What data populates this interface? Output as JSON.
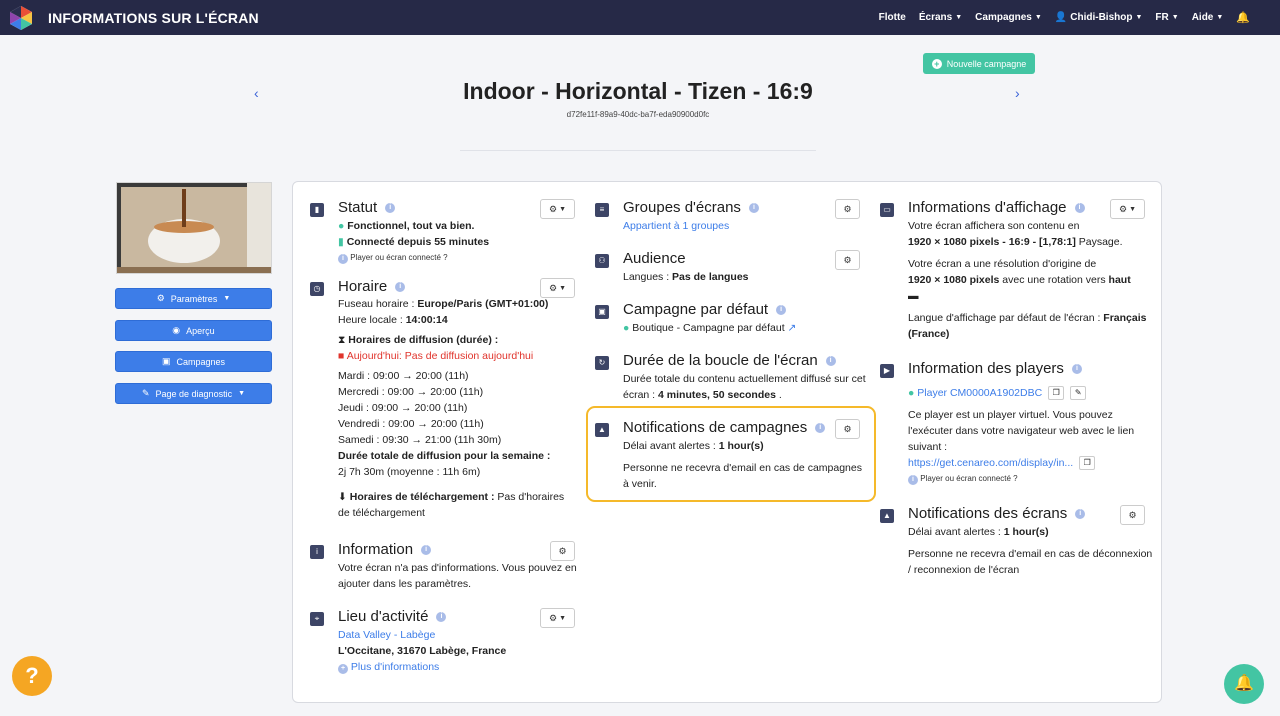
{
  "app": {
    "title": "INFORMATIONS SUR L'ÉCRAN"
  },
  "nav": {
    "items": [
      "Flotte",
      "Écrans",
      "Campagnes",
      "Chidi-Bishop",
      "FR",
      "Aide"
    ]
  },
  "new_campaign": {
    "label": "Nouvelle campagne"
  },
  "screen": {
    "name": "Indoor - Horizontal - Tizen - 16:9",
    "id": "d72fe11f-89a9-40dc-ba7f-eda90900d0fc"
  },
  "sidebar": {
    "buttons": [
      "Paramètres",
      "Aperçu",
      "Campagnes",
      "Page de diagnostic"
    ]
  },
  "statut": {
    "title": "Statut",
    "line1": "Fonctionnel, tout va bien.",
    "line2": "Connecté depuis 55 minutes",
    "note": "Player ou écran connecté ?"
  },
  "horaire": {
    "title": "Horaire",
    "tz_label": "Fuseau horaire : ",
    "tz_value": "Europe/Paris (GMT+01:00)",
    "local_label": "Heure locale : ",
    "local_value": "14:00:14",
    "diff_label": "Horaires de diffusion (durée) :",
    "today": "Aujourd'hui: Pas de diffusion aujourd'hui",
    "days": [
      "Mardi : 09:00 → 20:00 (11h)",
      "Mercredi : 09:00 → 20:00 (11h)",
      "Jeudi : 09:00 → 20:00 (11h)",
      "Vendredi : 09:00 → 20:00 (11h)",
      "Samedi : 09:30 → 21:00 (11h 30m)"
    ],
    "total_label": "Durée totale de diffusion pour la semaine :",
    "total_value": "2j 7h 30m (moyenne : 11h 6m)",
    "dl_label": "Horaires de téléchargement :",
    "dl_value1": " Pas d'horaires",
    "dl_value2": "de téléchargement"
  },
  "information": {
    "title": "Information",
    "line1": "Votre écran n'a pas d'informations. Vous pouvez en",
    "line2": "ajouter dans les paramètres."
  },
  "lieu": {
    "title": "Lieu d'activité",
    "link": "Data Valley - Labège",
    "address": "L'Occitane, 31670 Labège, France",
    "more": "Plus d'informations"
  },
  "groupes": {
    "title": "Groupes d'écrans",
    "value": "Appartient à 1 groupes"
  },
  "audience": {
    "title": "Audience",
    "label": "Langues : ",
    "value": "Pas de langues"
  },
  "campagne_defaut": {
    "title": "Campagne par défaut",
    "value": "Boutique - Campagne par défaut"
  },
  "boucle": {
    "title": "Durée de la boucle de l'écran",
    "line1": "Durée totale du contenu actuellement diffusé sur cet",
    "line2_label": "écran : ",
    "line2_value": "4 minutes, 50 secondes",
    "line2_end": " ."
  },
  "notif_campagnes": {
    "title": "Notifications de campagnes",
    "delay_label": "Délai avant alertes : ",
    "delay_value": "1 hour(s)",
    "line1": "Personne ne recevra d'email en cas de campagnes",
    "line2": "à venir."
  },
  "affichage": {
    "title": "Informations d'affichage",
    "line1": "Votre écran affichera son contenu en",
    "res1": "1920 × 1080 pixels - 16:9 - [1,78:1]",
    "res1_end": " Paysage.",
    "line2": "Votre écran a une résolution d'origine de",
    "res2": "1920  × 1080 pixels",
    "res2_mid": " avec une rotation vers ",
    "res2_end": "haut",
    "lang_label": "Langue d'affichage par défaut de l'écran : ",
    "lang_value": "Français",
    "lang_value2": "(France)"
  },
  "players": {
    "title": "Information des players",
    "player": "Player CM0000A1902DBC",
    "line1": "Ce player est un player virtuel. Vous pouvez",
    "line2": "l'exécuter dans votre navigateur web avec le lien",
    "line3": "suivant :",
    "url": "https://get.cenareo.com/display/in...",
    "note": "Player ou écran connecté ?"
  },
  "notif_ecrans": {
    "title": "Notifications des écrans",
    "delay_label": "Délai avant alertes : ",
    "delay_value": "1 hour(s)",
    "line1": "Personne ne recevra d'email en cas de déconnexion",
    "line2": "/ reconnexion de l'écran"
  },
  "colors": {
    "topbar": "#262947",
    "accent": "#3d7de8",
    "green": "#43c5a3",
    "highlight": "#f5b92a",
    "help": "#f5a623"
  },
  "icons": [
    "logo-icon",
    "bell-icon",
    "user-icon",
    "gear-icon",
    "eye-icon",
    "film-icon",
    "wrench-icon",
    "info-icon",
    "help-icon",
    "notification-bell-icon"
  ]
}
